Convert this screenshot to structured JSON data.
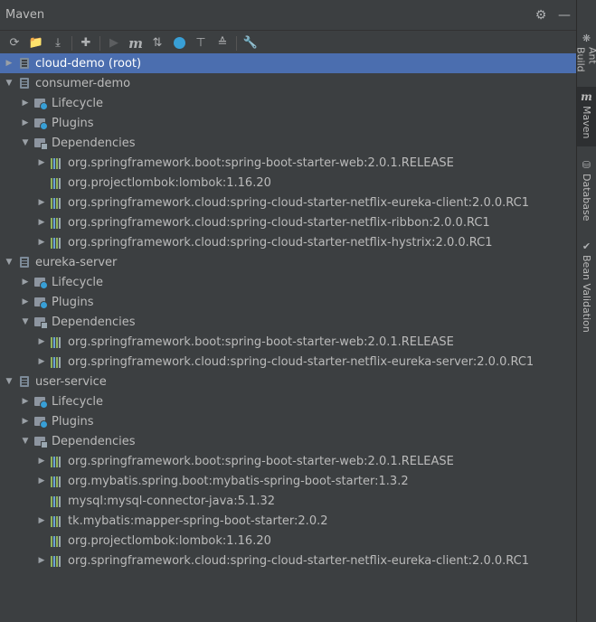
{
  "panel": {
    "title": "Maven"
  },
  "toolbar_icons": [
    "refresh-icon",
    "add-maven-project-icon",
    "download-sources-icon",
    "plus-icon",
    "run-icon",
    "execute-goal-icon",
    "toggle-offline-icon",
    "skip-tests-icon",
    "show-dependencies-icon",
    "collapse-all-icon",
    "settings-wrench-icon"
  ],
  "tree": [
    {
      "label": "cloud-demo (root)",
      "depth": 0,
      "icon": "module",
      "arrow": "right",
      "selected": true
    },
    {
      "label": "consumer-demo",
      "depth": 0,
      "icon": "module",
      "arrow": "down"
    },
    {
      "label": "Lifecycle",
      "depth": 1,
      "icon": "folder-gear",
      "arrow": "right"
    },
    {
      "label": "Plugins",
      "depth": 1,
      "icon": "folder-gear",
      "arrow": "right"
    },
    {
      "label": "Dependencies",
      "depth": 1,
      "icon": "folder-dep",
      "arrow": "down"
    },
    {
      "label": "org.springframework.boot:spring-boot-starter-web:2.0.1.RELEASE",
      "depth": 2,
      "icon": "library",
      "arrow": "right"
    },
    {
      "label": "org.projectlombok:lombok:1.16.20",
      "depth": 2,
      "icon": "library",
      "arrow": "none"
    },
    {
      "label": "org.springframework.cloud:spring-cloud-starter-netflix-eureka-client:2.0.0.RC1",
      "depth": 2,
      "icon": "library",
      "arrow": "right"
    },
    {
      "label": "org.springframework.cloud:spring-cloud-starter-netflix-ribbon:2.0.0.RC1",
      "depth": 2,
      "icon": "library",
      "arrow": "right"
    },
    {
      "label": "org.springframework.cloud:spring-cloud-starter-netflix-hystrix:2.0.0.RC1",
      "depth": 2,
      "icon": "library",
      "arrow": "right"
    },
    {
      "label": "eureka-server",
      "depth": 0,
      "icon": "module",
      "arrow": "down"
    },
    {
      "label": "Lifecycle",
      "depth": 1,
      "icon": "folder-gear",
      "arrow": "right"
    },
    {
      "label": "Plugins",
      "depth": 1,
      "icon": "folder-gear",
      "arrow": "right"
    },
    {
      "label": "Dependencies",
      "depth": 1,
      "icon": "folder-dep",
      "arrow": "down"
    },
    {
      "label": "org.springframework.boot:spring-boot-starter-web:2.0.1.RELEASE",
      "depth": 2,
      "icon": "library",
      "arrow": "right"
    },
    {
      "label": "org.springframework.cloud:spring-cloud-starter-netflix-eureka-server:2.0.0.RC1",
      "depth": 2,
      "icon": "library",
      "arrow": "right"
    },
    {
      "label": "user-service",
      "depth": 0,
      "icon": "module",
      "arrow": "down"
    },
    {
      "label": "Lifecycle",
      "depth": 1,
      "icon": "folder-gear",
      "arrow": "right"
    },
    {
      "label": "Plugins",
      "depth": 1,
      "icon": "folder-gear",
      "arrow": "right"
    },
    {
      "label": "Dependencies",
      "depth": 1,
      "icon": "folder-dep",
      "arrow": "down"
    },
    {
      "label": "org.springframework.boot:spring-boot-starter-web:2.0.1.RELEASE",
      "depth": 2,
      "icon": "library",
      "arrow": "right"
    },
    {
      "label": "org.mybatis.spring.boot:mybatis-spring-boot-starter:1.3.2",
      "depth": 2,
      "icon": "library",
      "arrow": "right"
    },
    {
      "label": "mysql:mysql-connector-java:5.1.32",
      "depth": 2,
      "icon": "library",
      "arrow": "none"
    },
    {
      "label": "tk.mybatis:mapper-spring-boot-starter:2.0.2",
      "depth": 2,
      "icon": "library",
      "arrow": "right"
    },
    {
      "label": "org.projectlombok:lombok:1.16.20",
      "depth": 2,
      "icon": "library",
      "arrow": "none"
    },
    {
      "label": "org.springframework.cloud:spring-cloud-starter-netflix-eureka-client:2.0.0.RC1",
      "depth": 2,
      "icon": "library",
      "arrow": "right"
    }
  ],
  "side_stripe": [
    {
      "label": "Ant Build",
      "icon": "ant-icon",
      "active": false
    },
    {
      "label": "Maven",
      "icon": "maven-m-icon",
      "active": true
    },
    {
      "label": "Database",
      "icon": "database-icon",
      "active": false
    },
    {
      "label": "Bean Validation",
      "icon": "bean-validation-icon",
      "active": false
    }
  ],
  "colors": {
    "background": "#3c3f41",
    "selection": "#4b6eaf",
    "text": "#bbbbbb"
  }
}
